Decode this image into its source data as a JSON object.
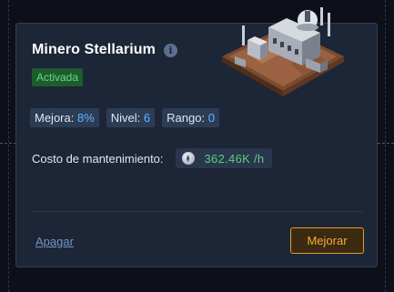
{
  "card": {
    "title": "Minero Stellarium",
    "status": "Activada",
    "stats": [
      {
        "label": "Mejora:",
        "value": "8%"
      },
      {
        "label": "Nivel:",
        "value": "6"
      },
      {
        "label": "Rango:",
        "value": "0"
      }
    ],
    "cost": {
      "label": "Costo de mantenimiento:",
      "icon": "silver-coin-icon",
      "value": "362.46K /h"
    },
    "actions": {
      "off_label": "Apagar",
      "upgrade_label": "Mejorar"
    }
  },
  "colors": {
    "background": "#0d1019",
    "card": "#1d2636",
    "status_green": "#5fe07c",
    "stat_value_blue": "#5cb7ff",
    "cost_green": "#56d07d",
    "accent_orange": "#f5ad36"
  }
}
